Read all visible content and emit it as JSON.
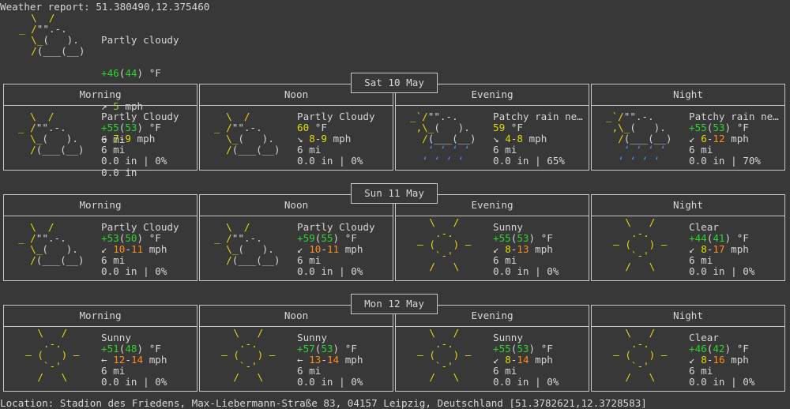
{
  "header": {
    "report_label": "Weather report: 51.380490,12.375460",
    "condition": "Partly cloudy",
    "temp_main": "+46",
    "temp_feel": "44",
    "temp_unit": " °F",
    "wind_arrow": "↗",
    "wind_speed": "5",
    "wind_unit": " mph",
    "visibility": "6 mi",
    "precip": "0.0 in"
  },
  "days": [
    {
      "date": "Sat 10 May",
      "periods": [
        {
          "name": "Morning",
          "icon": "partly-cloudy",
          "condition": "Partly Cloudy",
          "temp": "+55",
          "feel": "53",
          "arrow": "→",
          "wind_lo": "7",
          "wind_hi": "9",
          "visibility": "6 mi",
          "precip": "0.0 in | 0%"
        },
        {
          "name": "Noon",
          "icon": "partly-cloudy",
          "condition": "Partly Cloudy",
          "temp": "60",
          "feel": "",
          "arrow": "↘",
          "wind_lo": "8",
          "wind_hi": "9",
          "visibility": "6 mi",
          "precip": "0.0 in | 0%"
        },
        {
          "name": "Evening",
          "icon": "patchy-rain",
          "condition": "Patchy rain ne…",
          "temp": "59",
          "feel": "",
          "arrow": "↘",
          "wind_lo": "4",
          "wind_hi": "8",
          "visibility": "6 mi",
          "precip": "0.0 in | 65%"
        },
        {
          "name": "Night",
          "icon": "patchy-rain",
          "condition": "Patchy rain ne…",
          "temp": "+55",
          "feel": "53",
          "arrow": "↙",
          "wind_lo": "6",
          "wind_hi": "12",
          "visibility": "6 mi",
          "precip": "0.0 in | 70%"
        }
      ]
    },
    {
      "date": "Sun 11 May",
      "periods": [
        {
          "name": "Morning",
          "icon": "partly-cloudy",
          "condition": "Partly Cloudy",
          "temp": "+53",
          "feel": "50",
          "arrow": "↙",
          "wind_lo": "10",
          "wind_hi": "11",
          "visibility": "6 mi",
          "precip": "0.0 in | 0%"
        },
        {
          "name": "Noon",
          "icon": "partly-cloudy",
          "condition": "Partly Cloudy",
          "temp": "+59",
          "feel": "55",
          "arrow": "↙",
          "wind_lo": "10",
          "wind_hi": "11",
          "visibility": "6 mi",
          "precip": "0.0 in | 0%"
        },
        {
          "name": "Evening",
          "icon": "sun",
          "condition": "Sunny",
          "temp": "+55",
          "feel": "53",
          "arrow": "↙",
          "wind_lo": "8",
          "wind_hi": "13",
          "visibility": "6 mi",
          "precip": "0.0 in | 0%"
        },
        {
          "name": "Night",
          "icon": "sun",
          "condition": "Clear",
          "temp": "+44",
          "feel": "41",
          "arrow": "↙",
          "wind_lo": "8",
          "wind_hi": "17",
          "visibility": "6 mi",
          "precip": "0.0 in | 0%"
        }
      ]
    },
    {
      "date": "Mon 12 May",
      "periods": [
        {
          "name": "Morning",
          "icon": "sun",
          "condition": "Sunny",
          "temp": "+51",
          "feel": "48",
          "arrow": "←",
          "wind_lo": "12",
          "wind_hi": "14",
          "visibility": "6 mi",
          "precip": "0.0 in | 0%"
        },
        {
          "name": "Noon",
          "icon": "sun",
          "condition": "Sunny",
          "temp": "+57",
          "feel": "53",
          "arrow": "←",
          "wind_lo": "13",
          "wind_hi": "14",
          "visibility": "6 mi",
          "precip": "0.0 in | 0%"
        },
        {
          "name": "Evening",
          "icon": "sun",
          "condition": "Sunny",
          "temp": "+55",
          "feel": "53",
          "arrow": "↙",
          "wind_lo": "8",
          "wind_hi": "14",
          "visibility": "6 mi",
          "precip": "0.0 in | 0%"
        },
        {
          "name": "Night",
          "icon": "sun",
          "condition": "Clear",
          "temp": "+46",
          "feel": "42",
          "arrow": "↙",
          "wind_lo": "8",
          "wind_hi": "16",
          "visibility": "6 mi",
          "precip": "0.0 in | 0%"
        }
      ]
    }
  ],
  "temp_unit": " °F",
  "wind_unit": " mph",
  "footer": {
    "location": "Location: Stadion des Friedens, Max-Liebermann-Straße 83, 04157 Leipzig, Deutschland [51.3782621,12.3728583]"
  },
  "colors": {
    "background": "#383838",
    "text": "#d6d6d6",
    "sun": "#e8d70b",
    "rain": "#4f8fd6",
    "temp_green": "#2ed32e",
    "wind_yellow": "#dede00",
    "wind_orange": "#ff8c1a"
  }
}
